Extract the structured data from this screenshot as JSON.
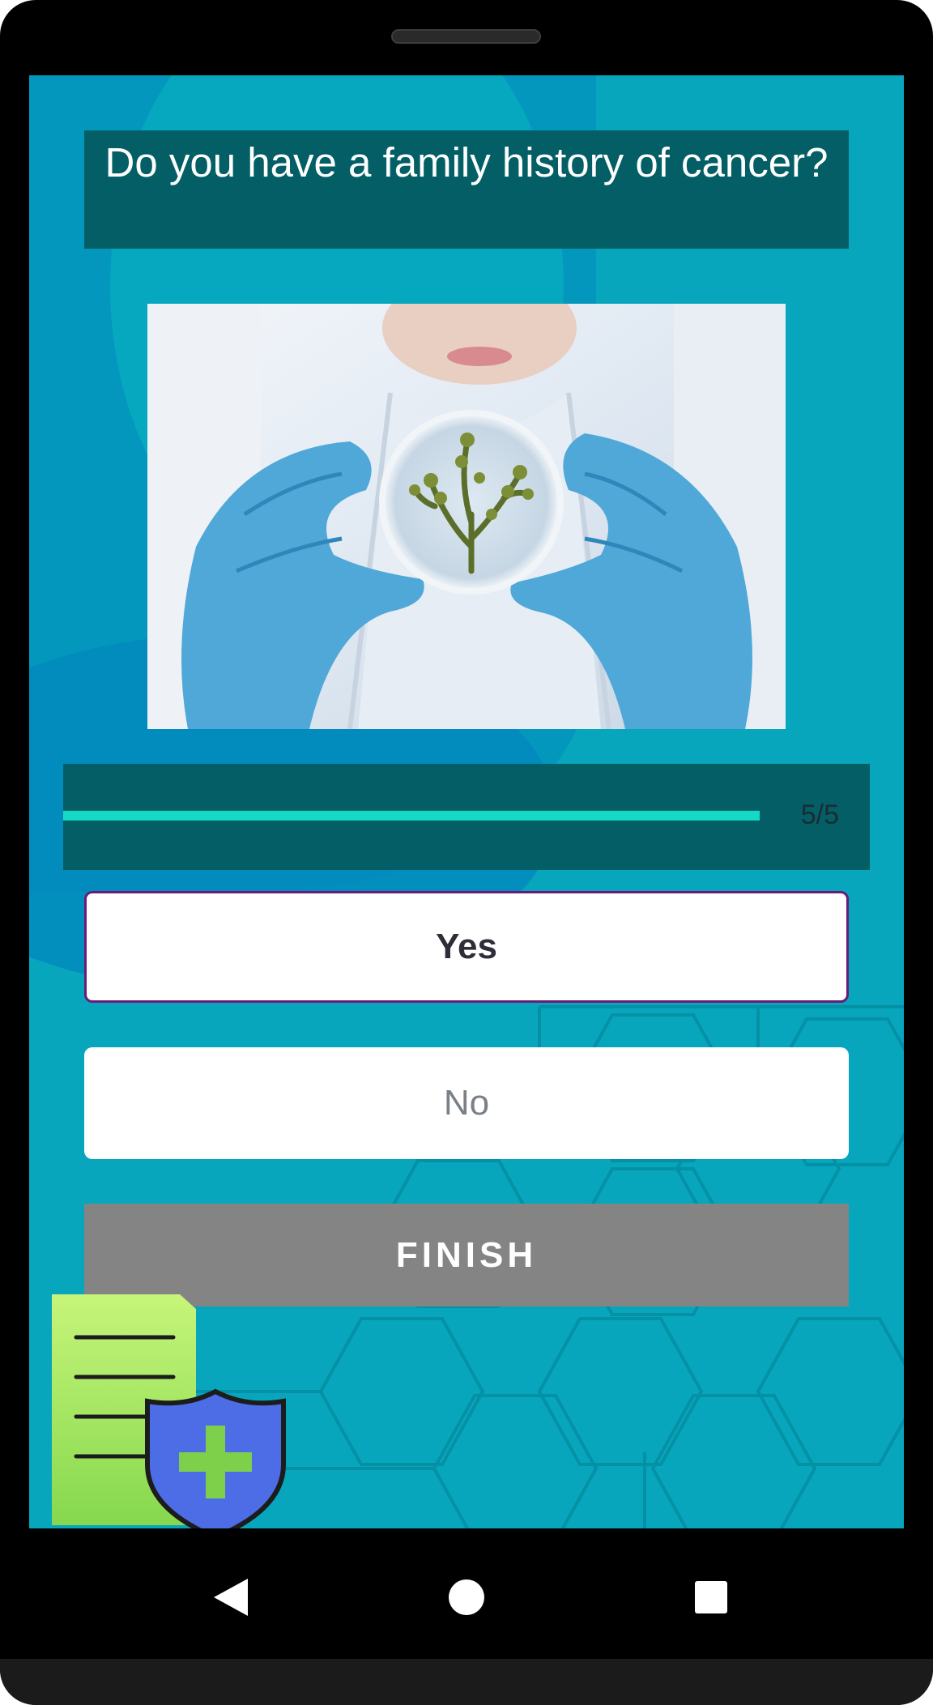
{
  "quiz": {
    "question": "Do you have a family history of cancer?",
    "progress": {
      "current": 5,
      "total": 5,
      "label": "5/5",
      "fraction_complete": 1.0
    },
    "options": [
      {
        "label": "Yes",
        "selected": true
      },
      {
        "label": "No",
        "selected": false
      }
    ],
    "finish_label": "FINISH"
  },
  "navigation": {
    "back_icon": "back-triangle-icon",
    "home_icon": "home-circle-icon",
    "recents_icon": "recents-square-icon"
  },
  "colors": {
    "screen_background": "#07a6bd",
    "panel": "#035f65",
    "progress_fill": "#14d9c4",
    "selected_border": "#6a1b7a",
    "finish_button": "#848484"
  }
}
